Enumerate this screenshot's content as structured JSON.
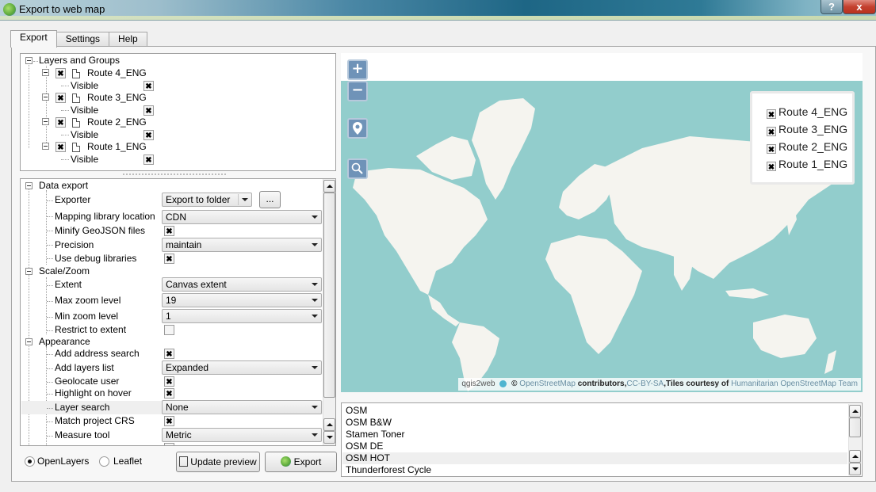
{
  "window": {
    "title": "Export to web map",
    "help_label": "?",
    "close_label": "x"
  },
  "tabs": [
    {
      "label": "Export",
      "active": true
    },
    {
      "label": "Settings",
      "active": false
    },
    {
      "label": "Help",
      "active": false
    }
  ],
  "layers_tree": {
    "root_label": "Layers and Groups",
    "layers": [
      {
        "name": "Route 4_ENG",
        "checked": true,
        "visible_label": "Visible",
        "visible": true
      },
      {
        "name": "Route 3_ENG",
        "checked": true,
        "visible_label": "Visible",
        "visible": true
      },
      {
        "name": "Route 2_ENG",
        "checked": true,
        "visible_label": "Visible",
        "visible": true
      },
      {
        "name": "Route 1_ENG",
        "checked": true,
        "visible_label": "Visible",
        "visible": true
      }
    ]
  },
  "settings": {
    "data_export": {
      "label": "Data export",
      "exporter_label": "Exporter",
      "exporter_value": "Export to folder",
      "browse_label": "...",
      "mapping_library_label": "Mapping library location",
      "mapping_library_value": "CDN",
      "minify_label": "Minify GeoJSON files",
      "minify_checked": true,
      "precision_label": "Precision",
      "precision_value": "maintain",
      "debug_label": "Use debug libraries",
      "debug_checked": true
    },
    "scale_zoom": {
      "label": "Scale/Zoom",
      "extent_label": "Extent",
      "extent_value": "Canvas extent",
      "max_zoom_label": "Max zoom level",
      "max_zoom_value": "19",
      "min_zoom_label": "Min zoom level",
      "min_zoom_value": "1",
      "restrict_label": "Restrict to extent",
      "restrict_checked": false
    },
    "appearance": {
      "label": "Appearance",
      "address_search_label": "Add address search",
      "address_search_checked": true,
      "layers_list_label": "Add layers list",
      "layers_list_value": "Expanded",
      "geolocate_label": "Geolocate user",
      "geolocate_checked": true,
      "highlight_label": "Highlight on hover",
      "highlight_checked": true,
      "layer_search_label": "Layer search",
      "layer_search_value": "None",
      "match_crs_label": "Match project CRS",
      "match_crs_checked": true,
      "measure_label": "Measure tool",
      "measure_value": "Metric"
    }
  },
  "library_options": [
    {
      "label": "OpenLayers",
      "selected": true
    },
    {
      "label": "Leaflet",
      "selected": false
    }
  ],
  "buttons": {
    "update_preview": "Update preview",
    "export": "Export"
  },
  "map_preview": {
    "zoom_in": "+",
    "zoom_out": "−",
    "layer_switcher": [
      "Route 4_ENG",
      "Route 3_ENG",
      "Route 2_ENG",
      "Route 1_ENG"
    ],
    "attribution": {
      "app": "qgis2web",
      "copyright": "©",
      "osm_link": "OpenStreetMap",
      "contributors": "contributors,",
      "license": "CC-BY-SA",
      "tiles_text": ",Tiles courtesy of",
      "hot_link": "Humanitarian OpenStreetMap Team"
    },
    "colors": {
      "sea": "#92cdcc",
      "land": "#f5f4ef",
      "control": "#6f93b8"
    }
  },
  "basemaps": [
    {
      "label": "OSM",
      "highlighted": false
    },
    {
      "label": "OSM B&W",
      "highlighted": false
    },
    {
      "label": "Stamen Toner",
      "highlighted": false
    },
    {
      "label": "OSM DE",
      "highlighted": false
    },
    {
      "label": "OSM HOT",
      "highlighted": true
    },
    {
      "label": "Thunderforest Cycle",
      "highlighted": false
    }
  ]
}
